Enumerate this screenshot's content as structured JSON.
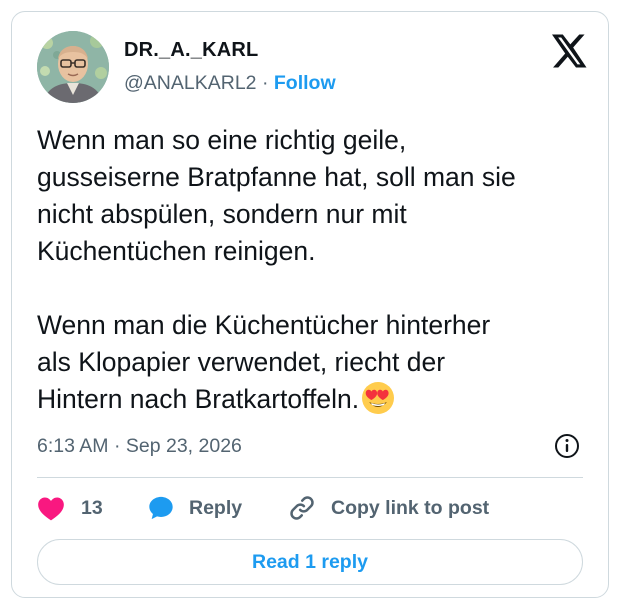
{
  "tweet": {
    "author": {
      "display_name": "DR._A._KARL",
      "handle": "@ANALKARL2",
      "separator": "·",
      "follow_label": "Follow"
    },
    "text": "Wenn man so eine richtig geile,\ngusseiserne Bratpfanne hat, soll man sie\nnicht abspülen, sondern nur mit\nKüchentüchen reinigen.\n\nWenn man die Küchentücher hinterher\nals Klopapier verwendet, riecht der\nHintern nach Bratkartoffeln.",
    "emoji": "smiling-face-with-heart-eyes",
    "timestamp": "6:13 AM · Sep 23, 2026",
    "actions": {
      "like_count": "13",
      "reply_label": "Reply",
      "copy_link_label": "Copy link to post"
    },
    "read_replies_label": "Read 1 reply"
  },
  "colors": {
    "text": "#0f1419",
    "secondary": "#536471",
    "accent": "#1d9bf0",
    "like": "#f91880",
    "border": "#cfd9de"
  },
  "icons": [
    "x-logo-icon",
    "info-icon",
    "heart-icon",
    "reply-bubble-icon",
    "link-icon",
    "heart-eyes-emoji-icon"
  ]
}
